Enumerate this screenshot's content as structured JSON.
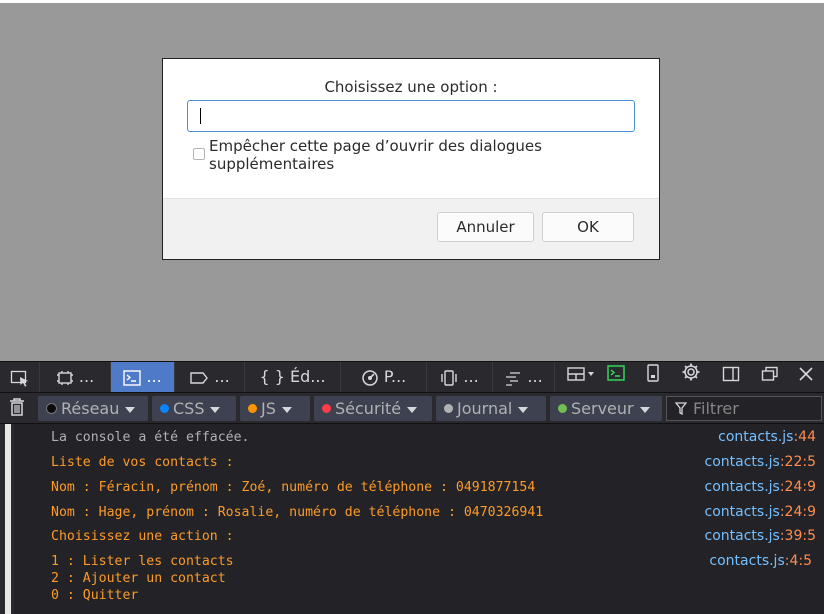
{
  "dialog": {
    "title": "Choisissez une option :",
    "input_value": "",
    "checkbox_label_line1": "Empêcher cette page d’ouvrir des dialogues",
    "checkbox_label_line2": "supplémentaires",
    "cancel_label": "Annuler",
    "ok_label": "OK"
  },
  "devtools": {
    "tabs": [
      {
        "label": "..."
      },
      {
        "label": "..."
      },
      {
        "label": "..."
      },
      {
        "label": "{ } Éd..."
      },
      {
        "label": "P..."
      },
      {
        "label": "..."
      },
      {
        "label": "..."
      }
    ],
    "filters": {
      "network": "Réseau",
      "css": "CSS",
      "js": "JS",
      "security": "Sécurité",
      "logging": "Journal",
      "server": "Serveur",
      "filter_placeholder": "Filtrer"
    },
    "console": [
      {
        "msg": "La console a été effacée.",
        "file": "contacts.js",
        "loc": ":44",
        "type": "info"
      },
      {
        "msg": "Liste de vos contacts :",
        "file": "contacts.js",
        "loc": ":22:5",
        "type": "log"
      },
      {
        "msg": "Nom : Féracin, prénom : Zoé, numéro de téléphone : 0491877154",
        "file": "contacts.js",
        "loc": ":24:9",
        "type": "log"
      },
      {
        "msg": "Nom : Hage, prénom : Rosalie, numéro de téléphone : 0470326941",
        "file": "contacts.js",
        "loc": ":24:9",
        "type": "log"
      },
      {
        "msg": "Choisissez une action :",
        "file": "contacts.js",
        "loc": ":39:5",
        "type": "log"
      },
      {
        "msg": "1 : Lister les contacts\n2 : Ajouter un contact\n0 : Quitter",
        "file": "contacts.js",
        "loc": ":4:5",
        "type": "log"
      }
    ]
  },
  "colors": {
    "log": "#fc9a28",
    "link": "#75bfff",
    "line_number": "#ff8d4e",
    "selected_tab": "#4f7ac7"
  }
}
